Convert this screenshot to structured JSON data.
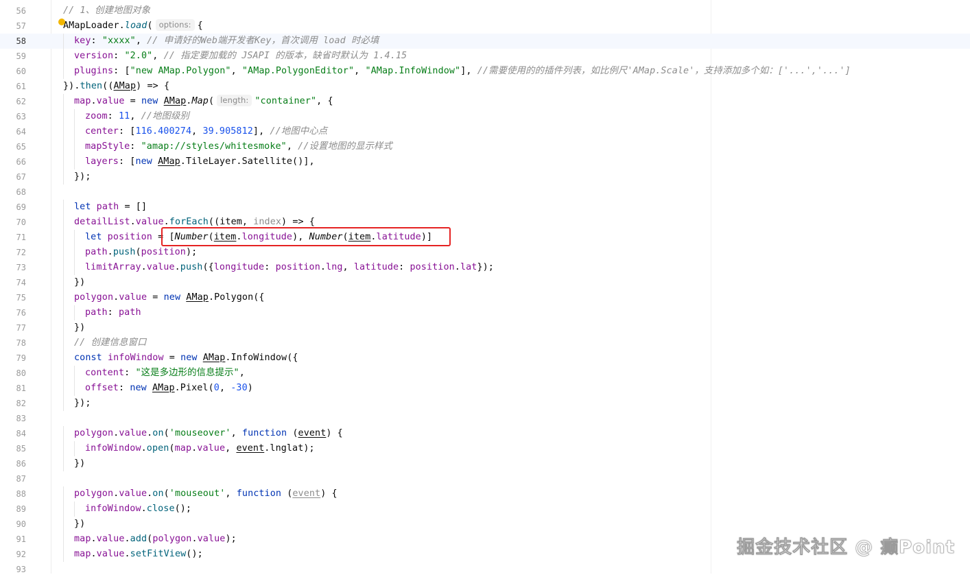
{
  "editor": {
    "language": "JavaScript",
    "current_line": 58
  },
  "lines": [
    {
      "num": 56,
      "tokens": [
        [
          "c",
          "// 1、创建地图对象"
        ]
      ]
    },
    {
      "num": 57,
      "tokens": [
        [
          "t",
          "AMapLoader."
        ],
        [
          "fi",
          "load"
        ],
        [
          "t",
          "("
        ],
        [
          "hint",
          "options:"
        ],
        [
          "t",
          "{"
        ]
      ]
    },
    {
      "num": 58,
      "tokens": [
        [
          "p",
          "key"
        ],
        [
          "t",
          ": "
        ],
        [
          "s",
          "\"xxxx\""
        ],
        [
          "t",
          ", "
        ],
        [
          "c",
          "// 申请好的Web端开发者Key，首次调用 load 时必填"
        ]
      ]
    },
    {
      "num": 59,
      "tokens": [
        [
          "p",
          "version"
        ],
        [
          "t",
          ": "
        ],
        [
          "s",
          "\"2.0\""
        ],
        [
          "t",
          ", "
        ],
        [
          "c",
          "// 指定要加载的 JSAPI 的版本，缺省时默认为 1.4.15"
        ]
      ]
    },
    {
      "num": 60,
      "tokens": [
        [
          "p",
          "plugins"
        ],
        [
          "t",
          ": ["
        ],
        [
          "s",
          "\"new AMap.Polygon\""
        ],
        [
          "t",
          ", "
        ],
        [
          "s",
          "\"AMap.PolygonEditor\""
        ],
        [
          "t",
          ", "
        ],
        [
          "s",
          "\"AMap.InfoWindow\""
        ],
        [
          "t",
          "], "
        ],
        [
          "c",
          "//需要使用的的插件列表，如比例尺'AMap.Scale'，支持添加多个如：['...','...']"
        ]
      ]
    },
    {
      "num": 61,
      "tokens": [
        [
          "t",
          "})."
        ],
        [
          "f",
          "then"
        ],
        [
          "t",
          "(("
        ],
        [
          "u",
          "AMap"
        ],
        [
          "t",
          ") => {"
        ]
      ]
    },
    {
      "num": 62,
      "tokens": [
        [
          "p",
          "map"
        ],
        [
          "t",
          "."
        ],
        [
          "p",
          "value"
        ],
        [
          "t",
          " = "
        ],
        [
          "k",
          "new "
        ],
        [
          "u",
          "AMap"
        ],
        [
          "t",
          "."
        ],
        [
          "i",
          "Map"
        ],
        [
          "t",
          "("
        ],
        [
          "hint",
          "length:"
        ],
        [
          "s",
          "\"container\""
        ],
        [
          "t",
          ", {"
        ]
      ]
    },
    {
      "num": 63,
      "tokens": [
        [
          "p",
          "zoom"
        ],
        [
          "t",
          ": "
        ],
        [
          "n",
          "11"
        ],
        [
          "t",
          ", "
        ],
        [
          "c",
          "//地图级别"
        ]
      ]
    },
    {
      "num": 64,
      "tokens": [
        [
          "p",
          "center"
        ],
        [
          "t",
          ": ["
        ],
        [
          "n",
          "116.400274"
        ],
        [
          "t",
          ", "
        ],
        [
          "n",
          "39.905812"
        ],
        [
          "t",
          "], "
        ],
        [
          "c",
          "//地图中心点"
        ]
      ]
    },
    {
      "num": 65,
      "tokens": [
        [
          "p",
          "mapStyle"
        ],
        [
          "t",
          ": "
        ],
        [
          "s",
          "\"amap://styles/whitesmoke\""
        ],
        [
          "t",
          ", "
        ],
        [
          "c",
          "//设置地图的显示样式"
        ]
      ]
    },
    {
      "num": 66,
      "tokens": [
        [
          "p",
          "layers"
        ],
        [
          "t",
          ": ["
        ],
        [
          "k",
          "new "
        ],
        [
          "u",
          "AMap"
        ],
        [
          "t",
          ".TileLayer.Satellite()],"
        ]
      ]
    },
    {
      "num": 67,
      "tokens": [
        [
          "t",
          "});"
        ]
      ]
    },
    {
      "num": 68,
      "tokens": []
    },
    {
      "num": 69,
      "tokens": [
        [
          "k",
          "let "
        ],
        [
          "p",
          "path"
        ],
        [
          "t",
          " = []"
        ]
      ]
    },
    {
      "num": 70,
      "tokens": [
        [
          "p",
          "detailList"
        ],
        [
          "t",
          "."
        ],
        [
          "p",
          "value"
        ],
        [
          "t",
          "."
        ],
        [
          "f",
          "forEach"
        ],
        [
          "t",
          "((item, "
        ],
        [
          "g",
          "index"
        ],
        [
          "t",
          ") => {"
        ]
      ]
    },
    {
      "num": 71,
      "tokens": [
        [
          "k",
          "let "
        ],
        [
          "p",
          "position"
        ],
        [
          "t",
          " = ["
        ],
        [
          "i",
          "Number"
        ],
        [
          "t",
          "("
        ],
        [
          "u",
          "item"
        ],
        [
          "t",
          "."
        ],
        [
          "p",
          "longitude"
        ],
        [
          "t",
          "), "
        ],
        [
          "i",
          "Number"
        ],
        [
          "t",
          "("
        ],
        [
          "u",
          "item"
        ],
        [
          "t",
          "."
        ],
        [
          "p",
          "latitude"
        ],
        [
          "t",
          ")]"
        ]
      ]
    },
    {
      "num": 72,
      "tokens": [
        [
          "p",
          "path"
        ],
        [
          "t",
          "."
        ],
        [
          "f",
          "push"
        ],
        [
          "t",
          "("
        ],
        [
          "p",
          "position"
        ],
        [
          "t",
          ");"
        ]
      ]
    },
    {
      "num": 73,
      "tokens": [
        [
          "p",
          "limitArray"
        ],
        [
          "t",
          "."
        ],
        [
          "p",
          "value"
        ],
        [
          "t",
          "."
        ],
        [
          "f",
          "push"
        ],
        [
          "t",
          "({"
        ],
        [
          "p",
          "longitude"
        ],
        [
          "t",
          ": "
        ],
        [
          "p",
          "position"
        ],
        [
          "t",
          "."
        ],
        [
          "p",
          "lng"
        ],
        [
          "t",
          ", "
        ],
        [
          "p",
          "latitude"
        ],
        [
          "t",
          ": "
        ],
        [
          "p",
          "position"
        ],
        [
          "t",
          "."
        ],
        [
          "p",
          "lat"
        ],
        [
          "t",
          "});"
        ]
      ]
    },
    {
      "num": 74,
      "tokens": [
        [
          "t",
          "})"
        ]
      ]
    },
    {
      "num": 75,
      "tokens": [
        [
          "p",
          "polygon"
        ],
        [
          "t",
          "."
        ],
        [
          "p",
          "value"
        ],
        [
          "t",
          " = "
        ],
        [
          "k",
          "new "
        ],
        [
          "u",
          "AMap"
        ],
        [
          "t",
          ".Polygon({"
        ]
      ]
    },
    {
      "num": 76,
      "tokens": [
        [
          "p",
          "path"
        ],
        [
          "t",
          ": "
        ],
        [
          "p",
          "path"
        ]
      ]
    },
    {
      "num": 77,
      "tokens": [
        [
          "t",
          "})"
        ]
      ]
    },
    {
      "num": 78,
      "tokens": [
        [
          "c",
          "// 创建信息窗口"
        ]
      ]
    },
    {
      "num": 79,
      "tokens": [
        [
          "k",
          "const "
        ],
        [
          "p",
          "infoWindow"
        ],
        [
          "t",
          " = "
        ],
        [
          "k",
          "new "
        ],
        [
          "u",
          "AMap"
        ],
        [
          "t",
          ".InfoWindow({"
        ]
      ]
    },
    {
      "num": 80,
      "tokens": [
        [
          "p",
          "content"
        ],
        [
          "t",
          ": "
        ],
        [
          "s",
          "\"这是多边形的信息提示\""
        ],
        [
          "t",
          ","
        ]
      ]
    },
    {
      "num": 81,
      "tokens": [
        [
          "p",
          "offset"
        ],
        [
          "t",
          ": "
        ],
        [
          "k",
          "new "
        ],
        [
          "u",
          "AMap"
        ],
        [
          "t",
          ".Pixel("
        ],
        [
          "n",
          "0"
        ],
        [
          "t",
          ", "
        ],
        [
          "n",
          "-30"
        ],
        [
          "t",
          ")"
        ]
      ]
    },
    {
      "num": 82,
      "tokens": [
        [
          "t",
          "});"
        ]
      ]
    },
    {
      "num": 83,
      "tokens": []
    },
    {
      "num": 84,
      "tokens": [
        [
          "p",
          "polygon"
        ],
        [
          "t",
          "."
        ],
        [
          "p",
          "value"
        ],
        [
          "t",
          "."
        ],
        [
          "f",
          "on"
        ],
        [
          "t",
          "("
        ],
        [
          "s",
          "'mouseover'"
        ],
        [
          "t",
          ", "
        ],
        [
          "k",
          "function "
        ],
        [
          "t",
          "("
        ],
        [
          "u",
          "event"
        ],
        [
          "t",
          ") {"
        ]
      ]
    },
    {
      "num": 85,
      "tokens": [
        [
          "p",
          "infoWindow"
        ],
        [
          "t",
          "."
        ],
        [
          "f",
          "open"
        ],
        [
          "t",
          "("
        ],
        [
          "p",
          "map"
        ],
        [
          "t",
          "."
        ],
        [
          "p",
          "value"
        ],
        [
          "t",
          ", "
        ],
        [
          "u",
          "event"
        ],
        [
          "t",
          ".lnglat);"
        ]
      ]
    },
    {
      "num": 86,
      "tokens": [
        [
          "t",
          "})"
        ]
      ]
    },
    {
      "num": 87,
      "tokens": []
    },
    {
      "num": 88,
      "tokens": [
        [
          "p",
          "polygon"
        ],
        [
          "t",
          "."
        ],
        [
          "p",
          "value"
        ],
        [
          "t",
          "."
        ],
        [
          "f",
          "on"
        ],
        [
          "t",
          "("
        ],
        [
          "s",
          "'mouseout'"
        ],
        [
          "t",
          ", "
        ],
        [
          "k",
          "function "
        ],
        [
          "t",
          "("
        ],
        [
          "gu",
          "event"
        ],
        [
          "t",
          ") {"
        ]
      ]
    },
    {
      "num": 89,
      "tokens": [
        [
          "p",
          "infoWindow"
        ],
        [
          "t",
          "."
        ],
        [
          "f",
          "close"
        ],
        [
          "t",
          "();"
        ]
      ]
    },
    {
      "num": 90,
      "tokens": [
        [
          "t",
          "})"
        ]
      ]
    },
    {
      "num": 91,
      "tokens": [
        [
          "p",
          "map"
        ],
        [
          "t",
          "."
        ],
        [
          "p",
          "value"
        ],
        [
          "t",
          "."
        ],
        [
          "f",
          "add"
        ],
        [
          "t",
          "("
        ],
        [
          "p",
          "polygon"
        ],
        [
          "t",
          "."
        ],
        [
          "p",
          "value"
        ],
        [
          "t",
          ");"
        ]
      ]
    },
    {
      "num": 92,
      "tokens": [
        [
          "p",
          "map"
        ],
        [
          "t",
          "."
        ],
        [
          "p",
          "value"
        ],
        [
          "t",
          "."
        ],
        [
          "f",
          "setFitView"
        ],
        [
          "t",
          "();"
        ]
      ]
    },
    {
      "num": 93,
      "tokens": []
    }
  ],
  "watermark": "掘金技术社区 @ 癫Point",
  "colors": {
    "keyword": "#0033b3",
    "string": "#067d17",
    "number": "#1750eb",
    "property": "#871094",
    "function": "#00627a",
    "comment": "#8c8c8c",
    "highlight_box": "#e52222"
  }
}
